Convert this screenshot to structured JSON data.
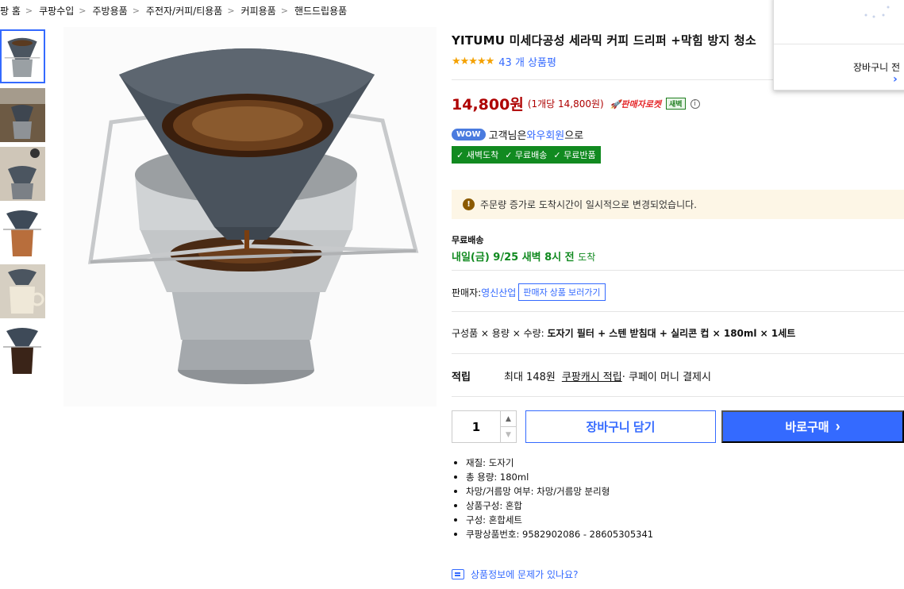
{
  "breadcrumb": [
    "팡 홈",
    "쿠팡수입",
    "주방용품",
    "주전자/커피/티용품",
    "커피용품",
    "핸드드립용품"
  ],
  "product": {
    "title": "YITUMU 미세다공성 세라믹 커피 드리퍼 +막힘 방지 청소",
    "stars": "★★★★★",
    "review_count": "43 개 상품평",
    "price": "14,800원",
    "unit_price": "(1개당 14,800원)",
    "rocket_label": "🚀판매자로켓",
    "dawn_badge": "새벽",
    "wow_badge": "WOW",
    "wow_prefix": "고객님은 ",
    "wow_member": "와우회원",
    "wow_suffix": "으로",
    "benefits": [
      "✓ 새벽도착",
      "✓ 무료배송",
      "✓ 무료반품"
    ],
    "notice": "주문량 증가로 도착시간이 일시적으로 변경되었습니다.",
    "shipping_label": "무료배송",
    "shipping_date": "내일(금) 9/25 새벽 8시 전",
    "shipping_arrive": "도착",
    "seller_label": "판매자: ",
    "seller_name": "영신산업",
    "seller_button": "판매자 상품 보러가기",
    "components_label": "구성품 × 용량 × 수량: ",
    "components_value": "도자기 필터 + 스텐 받침대 + 실리콘 컵 × 180ml × 1세트",
    "points_label": "적립",
    "points_text": "최대 148원",
    "points_link": "쿠팡캐시 적립",
    "points_suffix": " · 쿠페이 머니 결제시",
    "quantity": "1",
    "cart_button": "장바구니 담기",
    "buy_button": "바로구매",
    "buy_arrow": "›",
    "specs": [
      "재질: 도자기",
      "총 용량: 180ml",
      "차망/거름망 여부: 차망/거름망 분리형",
      "상품구성: 혼합",
      "구성: 혼합세트",
      "쿠팡상품번호: 9582902086 - 28605305341"
    ],
    "report_link": "상품정보에 문제가 있나요?"
  },
  "popup": {
    "text": "장바구니 전",
    "arrow": "›"
  },
  "icons": {
    "breadcrumb_sep": "chevron-right-icon",
    "info": "info-icon",
    "notice": "exclamation-icon",
    "qty_up": "caret-up-icon",
    "qty_down": "caret-down-icon",
    "report": "message-icon"
  },
  "colors": {
    "accent": "#346aff",
    "price": "#ae0000",
    "rocket": "#e52528",
    "benefit_bg": "#118a20",
    "notice_bg": "#fdf6e6"
  }
}
